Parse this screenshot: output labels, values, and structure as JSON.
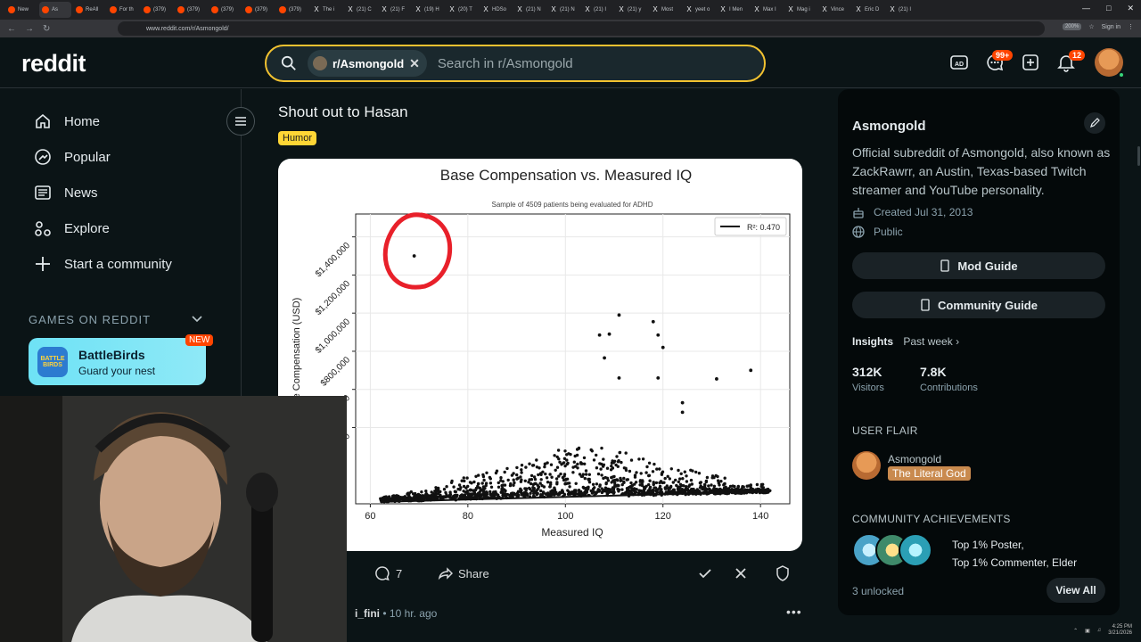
{
  "browser": {
    "tabs": [
      "New",
      "As",
      "ReAll",
      "For th",
      "(379)",
      "(379)",
      "(379)",
      "(379)",
      "(379)",
      "The i",
      "(21) C",
      "(21) F",
      "(19) H",
      "(20) T",
      "HDSo",
      "(21) N",
      "(21) N",
      "(21) I",
      "(21) y",
      "Most",
      "yeet o",
      "I Men",
      "Max I",
      "Mag i",
      "Vince",
      "Eric D",
      "(21) I"
    ],
    "url": "www.reddit.com/r/Asmongold/",
    "zoom": "200%",
    "sign_in": "Sign in"
  },
  "header": {
    "logo": "reddit",
    "subreddit_chip": "r/Asmongold",
    "search_placeholder": "Search in r/Asmongold",
    "chat_badge": "99+",
    "notif_badge": "12"
  },
  "left_sidebar": {
    "nav": [
      {
        "label": "Home",
        "icon": "home-icon"
      },
      {
        "label": "Popular",
        "icon": "popular-icon"
      },
      {
        "label": "News",
        "icon": "news-icon"
      },
      {
        "label": "Explore",
        "icon": "explore-icon"
      },
      {
        "label": "Start a community",
        "icon": "plus-icon"
      }
    ],
    "games_heading": "GAMES ON REDDIT",
    "game": {
      "title": "BattleBirds",
      "subtitle": "Guard your nest",
      "badge": "NEW",
      "logo_text": "BATTLE BIRDS"
    }
  },
  "post": {
    "title": "Shout out to Hasan",
    "flair": "Humor",
    "comments": "7",
    "share": "Share",
    "next_author": "i_fini",
    "next_time": "10 hr. ago"
  },
  "chart_data": {
    "type": "scatter",
    "title": "Base Compensation vs. Measured IQ",
    "subtitle": "Sample of 4509 patients being evaluated for ADHD",
    "xlabel": "Measured IQ",
    "ylabel": "Base Compensation (USD)",
    "xlim": [
      57,
      146
    ],
    "ylim": [
      0,
      1520000
    ],
    "xticks": [
      60,
      80,
      100,
      120,
      140
    ],
    "xtick_labels": [
      "60",
      "80",
      "100",
      "120",
      "140"
    ],
    "yticks": [
      400000,
      600000,
      800000,
      1000000,
      1200000,
      1400000
    ],
    "ytick_labels": [
      ".000",
      "$600,000",
      "$800,000",
      "$1,000,000",
      "$1,200,000",
      "$1,400,000"
    ],
    "legend": "R²: 0.470",
    "legend_position": "top-right",
    "grid": true,
    "trendline": {
      "x": [
        62,
        142
      ],
      "y": [
        10000,
        65000
      ]
    },
    "outliers": [
      {
        "x": 69,
        "y": 1300000
      },
      {
        "x": 111,
        "y": 990000
      },
      {
        "x": 107,
        "y": 885000
      },
      {
        "x": 109,
        "y": 890000
      },
      {
        "x": 118,
        "y": 955000
      },
      {
        "x": 119,
        "y": 885000
      },
      {
        "x": 120,
        "y": 820000
      },
      {
        "x": 108,
        "y": 765000
      },
      {
        "x": 111,
        "y": 660000
      },
      {
        "x": 119,
        "y": 660000
      },
      {
        "x": 131,
        "y": 655000
      },
      {
        "x": 138,
        "y": 700000
      },
      {
        "x": 124,
        "y": 530000
      },
      {
        "x": 124,
        "y": 480000
      }
    ],
    "cluster_description_points": "dense cloud of ~4500 points between IQ 62-142, mostly $0-$250,000",
    "highlight_circle": {
      "x": 69,
      "y": 1300000
    }
  },
  "right_sidebar": {
    "title": "Asmongold",
    "description": "Official subreddit of Asmongold, also known as ZackRawrr, an Austin, Texas-based Twitch streamer and YouTube personality.",
    "created": "Created Jul 31, 2013",
    "visibility": "Public",
    "mod_guide": "Mod Guide",
    "community_guide": "Community Guide",
    "insights_label": "Insights",
    "insights_range": "Past week",
    "visitors_num": "312K",
    "visitors_label": "Visitors",
    "contrib_num": "7.8K",
    "contrib_label": "Contributions",
    "user_flair_heading": "USER FLAIR",
    "flair_user": "Asmongold",
    "flair_tag": "The Literal God",
    "achievements_heading": "COMMUNITY ACHIEVEMENTS",
    "achievement_1": "Top 1% Poster,",
    "achievement_2": "Top 1% Commenter, Elder",
    "unlocked": "3 unlocked",
    "view_all": "View All"
  },
  "tray": {
    "time": "4:25 PM",
    "date": "3/21/2026"
  },
  "colors": {
    "accent": "#ff4500",
    "search_border": "#f2c230",
    "flair_bg": "#ffd635",
    "highlight_red": "#e8202a"
  }
}
